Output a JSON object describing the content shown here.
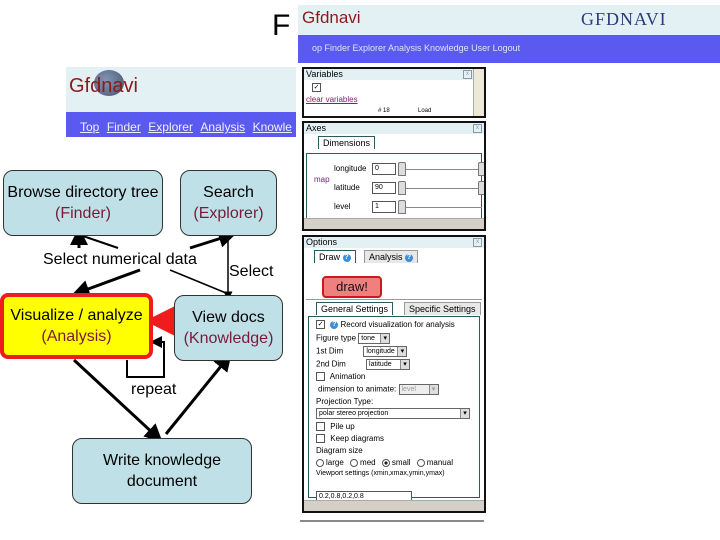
{
  "slide": {
    "title_fragment": "F"
  },
  "header_top": {
    "logo": "Gfdnavi",
    "brand": "GFDNAVI",
    "nav_text": "op Finder Explorer Analysis Knowledge User Logout"
  },
  "header_left": {
    "logo": "Gfdnavi",
    "nav_links": [
      "Top",
      "Finder",
      "Explorer",
      "Analysis",
      "Knowle"
    ]
  },
  "diagram": {
    "nodes": {
      "finder": {
        "label": "Browse directory tree",
        "sub": "(Finder)"
      },
      "explorer": {
        "label": "Search",
        "sub": "(Explorer)"
      },
      "analysis": {
        "label": "Visualize / analyze",
        "sub": "(Analysis)"
      },
      "knowledge": {
        "label": "View docs",
        "sub": "(Knowledge)"
      },
      "write": {
        "label": "Write knowledge",
        "sub": "document"
      }
    },
    "edge_labels": {
      "select_numerical": "Select numerical data",
      "select": "Select",
      "repeat": "repeat"
    },
    "colors": {
      "node_fill": "#bfe0e6",
      "highlight_fill": "#ffff00",
      "highlight_border": "#ee1c1c",
      "sub_text": "#7a1a3a"
    }
  },
  "ui_panel": {
    "variables": {
      "title": "Variables",
      "checkbox_checked": true,
      "clear_link": "clear variables",
      "buttons": [
        "# 18",
        "Load"
      ]
    },
    "axes": {
      "title": "Axes",
      "tab": "Dimensions",
      "group_label": "map",
      "dims": [
        {
          "name": "longitude",
          "value": "0"
        },
        {
          "name": "latitude",
          "value": "90"
        },
        {
          "name": "level",
          "value": "1"
        }
      ]
    },
    "options": {
      "title": "Options",
      "tabs": [
        "Draw",
        "Analysis"
      ],
      "draw_button": "draw!",
      "sub_tabs": [
        "General Settings",
        "Specific Settings"
      ],
      "record_visualization": "Record visualization for analysis",
      "figure_type_label": "Figure type",
      "figure_type_value": "tone",
      "first_dim_label": "1st Dim",
      "first_dim_value": "longitude",
      "second_dim_label": "2nd Dim",
      "second_dim_value": "latitude",
      "animation_label": "Animation",
      "animate_dim_label": "dimension to animate:",
      "animate_dim_value": "level",
      "projection_label": "Projection Type:",
      "projection_value": "polar stereo projection",
      "pile_up_label": "Pile up",
      "keep_diagrams_label": "Keep diagrams",
      "diagram_size_label": "Diagram size",
      "diagram_sizes": [
        "large",
        "med",
        "small",
        "manual"
      ],
      "diagram_size_selected": "small",
      "viewport_label": "Viewport settings (xmin,xmax,ymin,ymax)",
      "viewport_value": "0.2,0.8,0.2,0.8"
    }
  }
}
